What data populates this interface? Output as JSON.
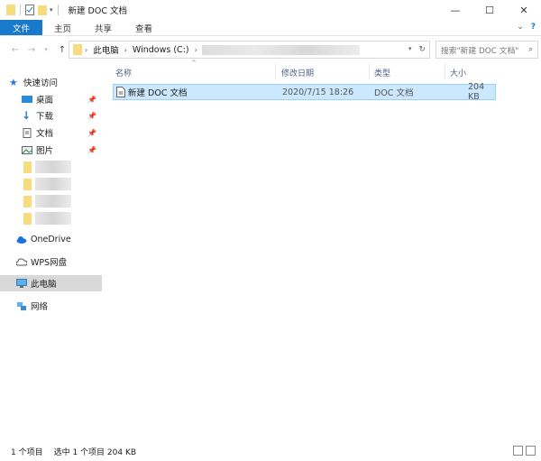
{
  "window": {
    "title": "新建 DOC 文档",
    "minimize": "—",
    "maximize": "☐",
    "close": "✕"
  },
  "ribbon": {
    "tabs": [
      "文件",
      "主页",
      "共享",
      "查看"
    ]
  },
  "address": {
    "crumbs": [
      "此电脑",
      "Windows (C:)"
    ],
    "search_placeholder": "搜索\"新建 DOC 文档\""
  },
  "nav": {
    "quick_access": "快速访问",
    "desktop": "桌面",
    "downloads": "下载",
    "documents": "文档",
    "pictures": "图片",
    "onedrive": "OneDrive",
    "wps": "WPS网盘",
    "this_pc": "此电脑",
    "network": "网络"
  },
  "columns": {
    "name": "名称",
    "modified": "修改日期",
    "type": "类型",
    "size": "大小"
  },
  "files": [
    {
      "name": "新建 DOC 文档",
      "modified": "2020/7/15 18:26",
      "type": "DOC 文档",
      "size": "204 KB"
    }
  ],
  "status": {
    "item_count": "1 个项目",
    "selection": "选中 1 个项目  204 KB"
  },
  "colors": {
    "accent": "#1979ca",
    "selection_bg": "#cce8ff",
    "selection_border": "#99d1ff",
    "folder": "#f6dc7f"
  }
}
